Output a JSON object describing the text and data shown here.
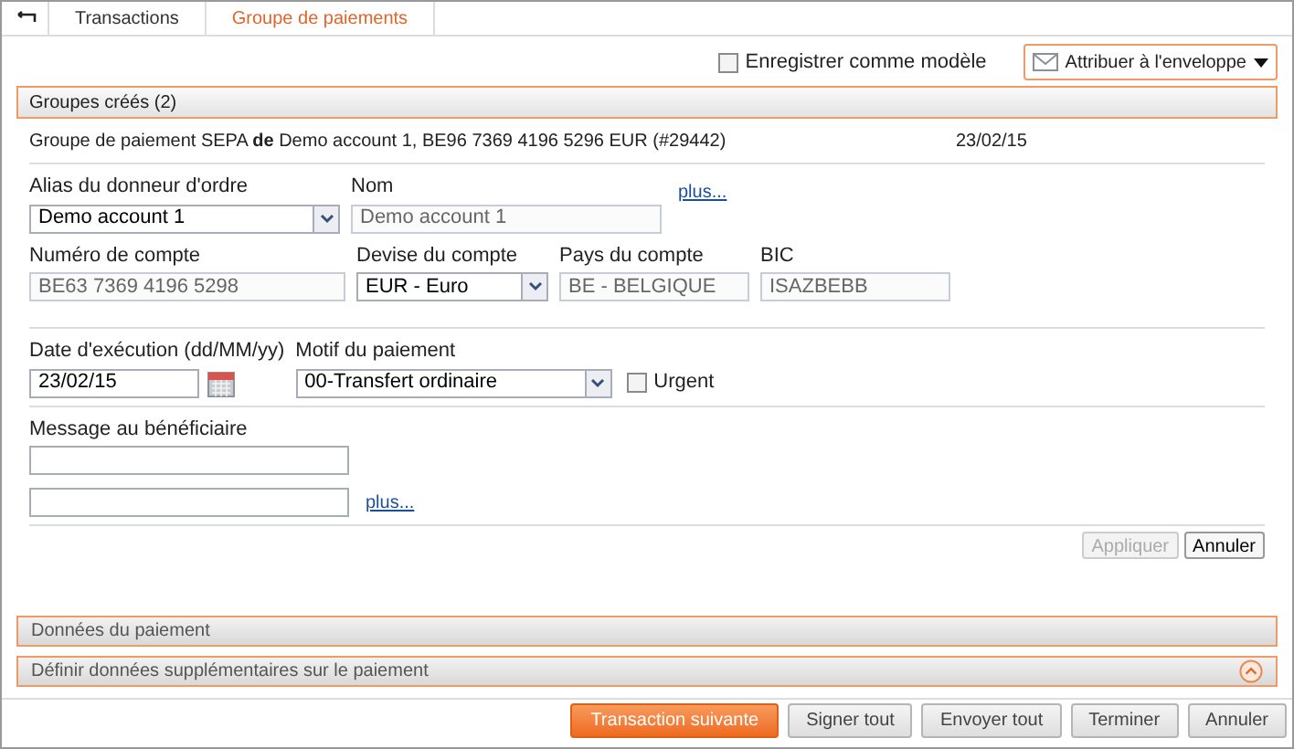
{
  "breadcrumb": [
    {
      "label": "Transactions",
      "selected": false
    },
    {
      "label": "Groupe de paiements",
      "selected": true
    }
  ],
  "save_template": {
    "label": "Enregistrer comme modèle",
    "checked": false
  },
  "envelope_button": {
    "label": "Attribuer à l'enveloppe"
  },
  "groups_header": {
    "title": "Groupes créés (2)"
  },
  "group": {
    "title": "Groupe de paiement SEPA **de** Demo account 1, BE96 7369 4196 5296 EUR (#29442)",
    "date": "23/02/15"
  },
  "sections": [
    {
      "rows": [
        [
          {
            "kind": "select",
            "label": "Alias du donneur d'ordre",
            "value": "Demo account 1",
            "disabled": false
          },
          {
            "kind": "input",
            "label": "Nom",
            "value": "Demo account 1",
            "disabled": true
          },
          {
            "kind": "link",
            "value": "plus..."
          }
        ],
        [
          {
            "kind": "input",
            "label": "Numéro de compte",
            "value": "BE63 7369 4196 5298",
            "disabled": true
          },
          {
            "kind": "select",
            "label": "Devise du compte",
            "value": "EUR - Euro",
            "disabled": false
          },
          {
            "kind": "input",
            "label": "Pays du compte",
            "value": "BE - BELGIQUE",
            "disabled": true
          },
          {
            "kind": "input",
            "label": "BIC",
            "value": "ISAZBEBB",
            "disabled": true
          }
        ]
      ]
    },
    {
      "rows": [
        [
          {
            "kind": "date",
            "label": "Date d'exécution (dd/MM/yy)",
            "value": "23/02/15",
            "disabled": false
          },
          {
            "kind": "select",
            "label": "Motif du paiement",
            "value": "00-Transfert ordinaire",
            "disabled": false
          },
          {
            "kind": "checkbox",
            "value": "Urgent",
            "checked": false
          }
        ]
      ]
    },
    {
      "rows": [
        [
          {
            "kind": "input",
            "label": "Message au bénéficiaire",
            "disabled": false
          }
        ],
        [
          {
            "kind": "input",
            "disabled": false
          },
          {
            "kind": "link",
            "value": "plus..."
          }
        ]
      ]
    }
  ],
  "form_buttons": [
    {
      "label": "Appliquer",
      "disabled": true
    },
    {
      "label": "Annuler",
      "disabled": false
    }
  ],
  "panels": [
    {
      "title": "Données du paiement",
      "kind": "plain"
    },
    {
      "title": "Définir données supplémentaires sur le paiement",
      "kind": "toggle"
    }
  ],
  "footer_buttons": [
    {
      "label": "Transaction suivante",
      "kind": "primary"
    },
    {
      "label": "Signer tout",
      "kind": "default"
    },
    {
      "label": "Envoyer tout",
      "kind": "default"
    },
    {
      "label": "Terminer",
      "kind": "default"
    },
    {
      "label": "Annuler",
      "kind": "default"
    }
  ]
}
